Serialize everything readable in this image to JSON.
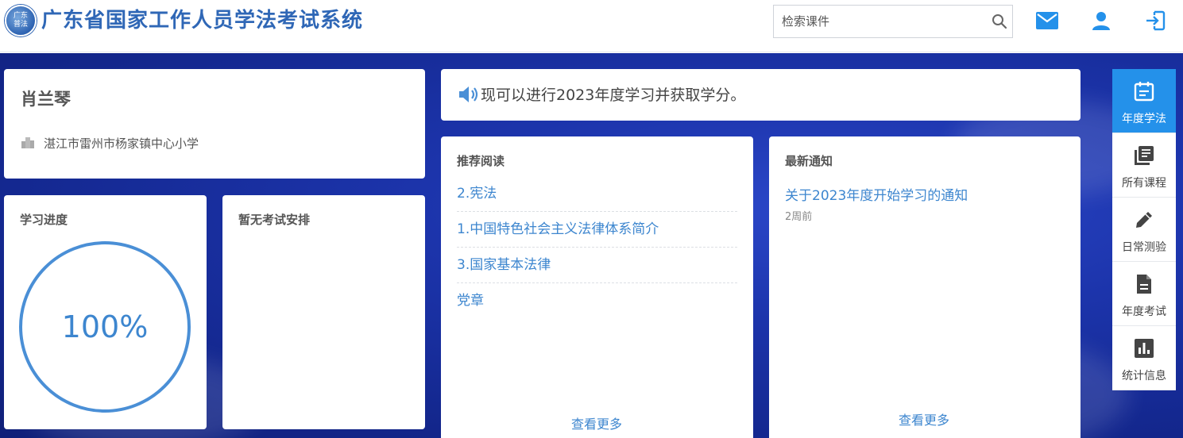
{
  "header": {
    "logo_text": [
      "广东",
      "普法"
    ],
    "title": "广东省国家工作人员学法考试系统",
    "search": {
      "placeholder": "检索课件"
    },
    "icons": [
      "mail-icon",
      "user-icon",
      "logout-icon"
    ],
    "accent_color": "#2491ea"
  },
  "profile": {
    "name": "肖兰琴",
    "organization": "湛江市雷州市杨家镇中心小学"
  },
  "progress": {
    "title": "学习进度",
    "value": 1.0,
    "label": "100%"
  },
  "exam": {
    "title": "暂无考试安排"
  },
  "announcement": {
    "text": "现可以进行2023年度学习并获取学分。"
  },
  "reading": {
    "title": "推荐阅读",
    "items": [
      "2.宪法",
      "1.中国特色社会主义法律体系简介",
      "3.国家基本法律",
      "党章"
    ],
    "more": "查看更多"
  },
  "notices": {
    "title": "最新通知",
    "items": [
      {
        "title": "关于2023年度开始学习的通知",
        "time": "2周前"
      }
    ],
    "more": "查看更多"
  },
  "side_nav": {
    "items": [
      {
        "label": "年度学法",
        "icon": "calendar-icon",
        "active": true
      },
      {
        "label": "所有课程",
        "icon": "library-books-icon",
        "active": false
      },
      {
        "label": "日常测验",
        "icon": "pencil-icon",
        "active": false
      },
      {
        "label": "年度考试",
        "icon": "document-icon",
        "active": false
      },
      {
        "label": "统计信息",
        "icon": "bar-chart-icon",
        "active": false
      }
    ]
  }
}
